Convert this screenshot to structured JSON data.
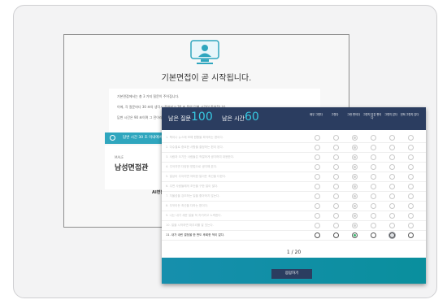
{
  "intro": {
    "title": "기본면접이 곧 시작됩니다.",
    "notes": [
      "기본면접에서는 총 3 가지 질문이 주어집니다.",
      "이에, 각 질문마다 30 초의 생각시 주어지고 30 초 동안 답변 시간이 주어집니다.",
      "답변 시간은 90 초이며 그 전이라도 답변이 끝나면 다음 질문으로 넘어갑니다."
    ],
    "timer_text": "답변 시간 30 초 이내에서 답변해주세요.",
    "profile_tag": "MALE",
    "profile_name": "남성면접관",
    "footer_text": "AI면접관의 질문"
  },
  "questionnaire": {
    "remaining_questions_label": "남은 질문",
    "remaining_questions": "100",
    "remaining_time_label": "남은 시간",
    "remaining_time": "60",
    "columns": [
      "매우 그렇다",
      "그렇다",
      "그런 편이다",
      "그렇지 않은 편이다",
      "그렇지 않다",
      "전혀 그렇지 않다"
    ],
    "questions": [
      {
        "text": "1. 책이나 뉴스에 보해 원활을 파악하는 편이다.",
        "selected": 2,
        "active": false
      },
      {
        "text": "2. 다수결로 중요한 사항을 결정하는 편이 된다.",
        "selected": 2,
        "active": false
      },
      {
        "text": "3. 사람과 오기간 사람들은 적절하게 생각하여 대응한다.",
        "selected": 2,
        "active": false
      },
      {
        "text": "4. 주어지면 다양한 방법으로 생각해 본다.",
        "selected": 2,
        "active": false
      },
      {
        "text": "5. 일상이 주어지면 어떠한 일이든 최선을 다한다.",
        "selected": 2,
        "active": false
      },
      {
        "text": "6. 주변 사람들에게 조언을 구한 일이 많다.",
        "selected": 2,
        "active": false
      },
      {
        "text": "7. 자율성을 강조하는 일을 좋아하지 않는다.",
        "selected": 2,
        "active": false
      },
      {
        "text": "8. 무엇이든 최선을 다하는 편이다.",
        "selected": 2,
        "active": false
      },
      {
        "text": "9. 나는 내가 세운 일을 꼭 지키려고 노력한다.",
        "selected": 2,
        "active": false
      },
      {
        "text": "10. 일을 시작하면 마무리를 잘 짓는다.",
        "selected": 2,
        "active": false
      },
      {
        "text": "11. 내가 내린 결정을 한 번도 후회한 적이 없다.",
        "selected": 2,
        "active": true,
        "hover": 4
      }
    ],
    "page_indicator": "1 / 20",
    "submit_label": "응답하기"
  },
  "colors": {
    "accent": "#37c9e2",
    "header_bg": "#2b3d60",
    "panel_bg": "#168fad",
    "selected_radio": "#39b56b"
  }
}
